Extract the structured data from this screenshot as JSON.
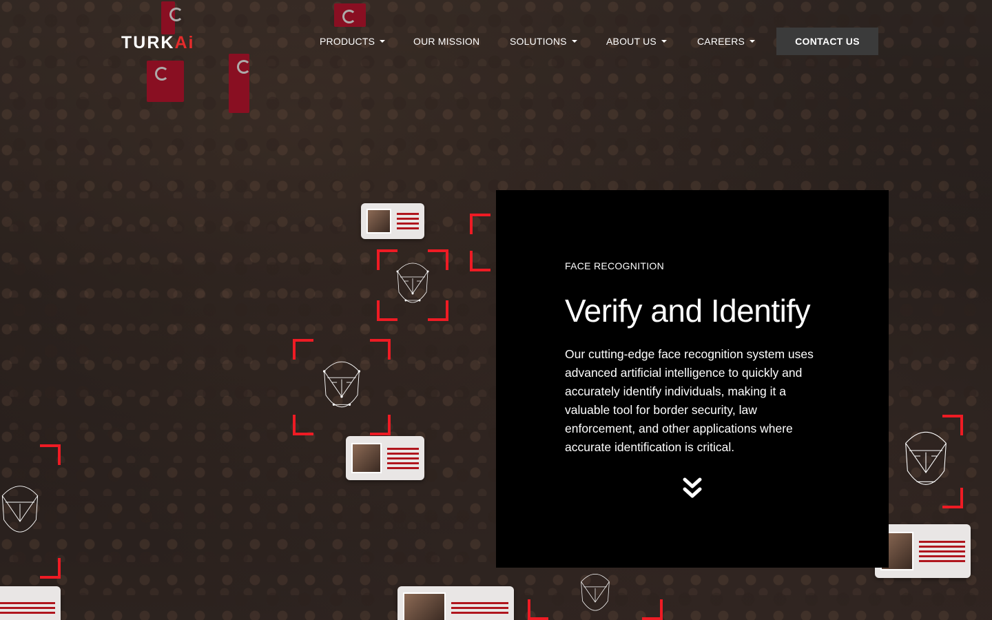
{
  "brand": {
    "logo_main": "TURK",
    "logo_accent": "Ai"
  },
  "nav": {
    "items": [
      {
        "label": "PRODUCTS",
        "dropdown": true
      },
      {
        "label": "OUR MISSION",
        "dropdown": false
      },
      {
        "label": "SOLUTIONS",
        "dropdown": true
      },
      {
        "label": "ABOUT US",
        "dropdown": true
      },
      {
        "label": "CAREERS",
        "dropdown": true
      }
    ],
    "cta_label": "CONTACT US"
  },
  "hero": {
    "eyebrow": "FACE RECOGNITION",
    "title": "Verify and Identify",
    "body": "Our cutting-edge face recognition system uses advanced artificial intelligence to quickly and accurately identify individuals, making it a valuable tool for border security, law enforcement, and other applications where accurate identification is critical.",
    "scroll_icon": "double-chevron-down-icon"
  },
  "colors": {
    "accent": "#ee1b24",
    "panel": "#000000",
    "cta_bg": "#3b3b3b"
  }
}
